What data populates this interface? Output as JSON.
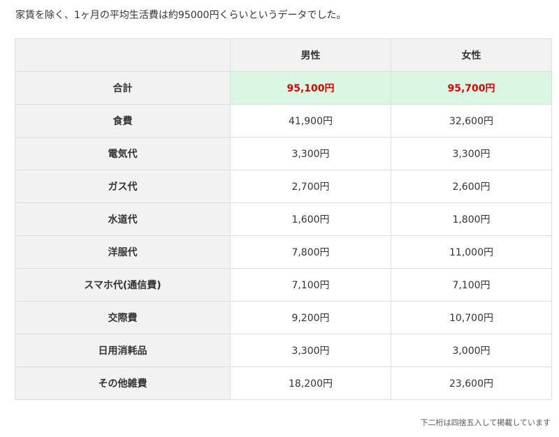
{
  "intro_text": "家賃を除く、1ヶ月の平均生活費は約95000円くらいというデータでした。",
  "table": {
    "header": {
      "corner": "",
      "male": "男性",
      "female": "女性"
    },
    "rows": [
      {
        "label": "合計",
        "male": "95,100円",
        "female": "95,700円",
        "highlight": true
      },
      {
        "label": "食費",
        "male": "41,900円",
        "female": "32,600円"
      },
      {
        "label": "電気代",
        "male": "3,300円",
        "female": "3,300円"
      },
      {
        "label": "ガス代",
        "male": "2,700円",
        "female": "2,600円"
      },
      {
        "label": "水道代",
        "male": "1,600円",
        "female": "1,800円"
      },
      {
        "label": "洋服代",
        "male": "7,800円",
        "female": "11,000円"
      },
      {
        "label": "スマホ代(通信費)",
        "male": "7,100円",
        "female": "7,100円"
      },
      {
        "label": "交際費",
        "male": "9,200円",
        "female": "10,700円"
      },
      {
        "label": "日用消耗品",
        "male": "3,300円",
        "female": "3,000円"
      },
      {
        "label": "その他雑費",
        "male": "18,200円",
        "female": "23,600円"
      }
    ]
  },
  "colors": {
    "total_highlight_bg": "#d9f7e3",
    "total_text": "#e00000",
    "header_bg": "#f2f2f2"
  },
  "footnote": "下二桁は四捨五入して掲載しています"
}
